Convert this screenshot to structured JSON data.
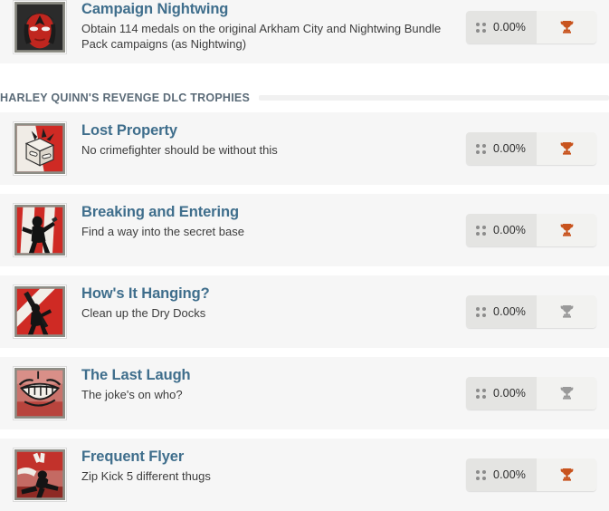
{
  "page": {
    "progress_icon_name": "dots-grid-icon"
  },
  "top_item": {
    "title": "Campaign Nightwing",
    "description": "Obtain 114 medals on the original Arkham City and Nightwing Bundle Pack campaigns (as Nightwing)",
    "progress": "0.00%",
    "trophy_type": "bronze",
    "icon_name": "nightwing-face-icon"
  },
  "section": {
    "title": "HARLEY QUINN'S REVENGE DLC TROPHIES"
  },
  "trophies": [
    {
      "title": "Lost Property",
      "description": "No crimefighter should be without this",
      "progress": "0.00%",
      "trophy_type": "bronze",
      "icon_name": "open-box-icon"
    },
    {
      "title": "Breaking and Entering",
      "description": "Find a way into the secret base",
      "progress": "0.00%",
      "trophy_type": "bronze",
      "icon_name": "breaking-window-icon"
    },
    {
      "title": "How's It Hanging?",
      "description": "Clean up the Dry Docks",
      "progress": "0.00%",
      "trophy_type": "grey",
      "icon_name": "hanging-figure-icon"
    },
    {
      "title": "The Last Laugh",
      "description": "The joke's on who?",
      "progress": "0.00%",
      "trophy_type": "grey",
      "icon_name": "joker-grin-icon"
    },
    {
      "title": "Frequent Flyer",
      "description": "Zip Kick 5 different thugs",
      "progress": "0.00%",
      "trophy_type": "bronze",
      "icon_name": "zip-kick-icon"
    }
  ],
  "colors": {
    "trophy_bronze": "#c8531d",
    "trophy_grey": "#9a9a9a",
    "title_blue": "#3f6e8c",
    "section_grey": "#5b6b78"
  }
}
